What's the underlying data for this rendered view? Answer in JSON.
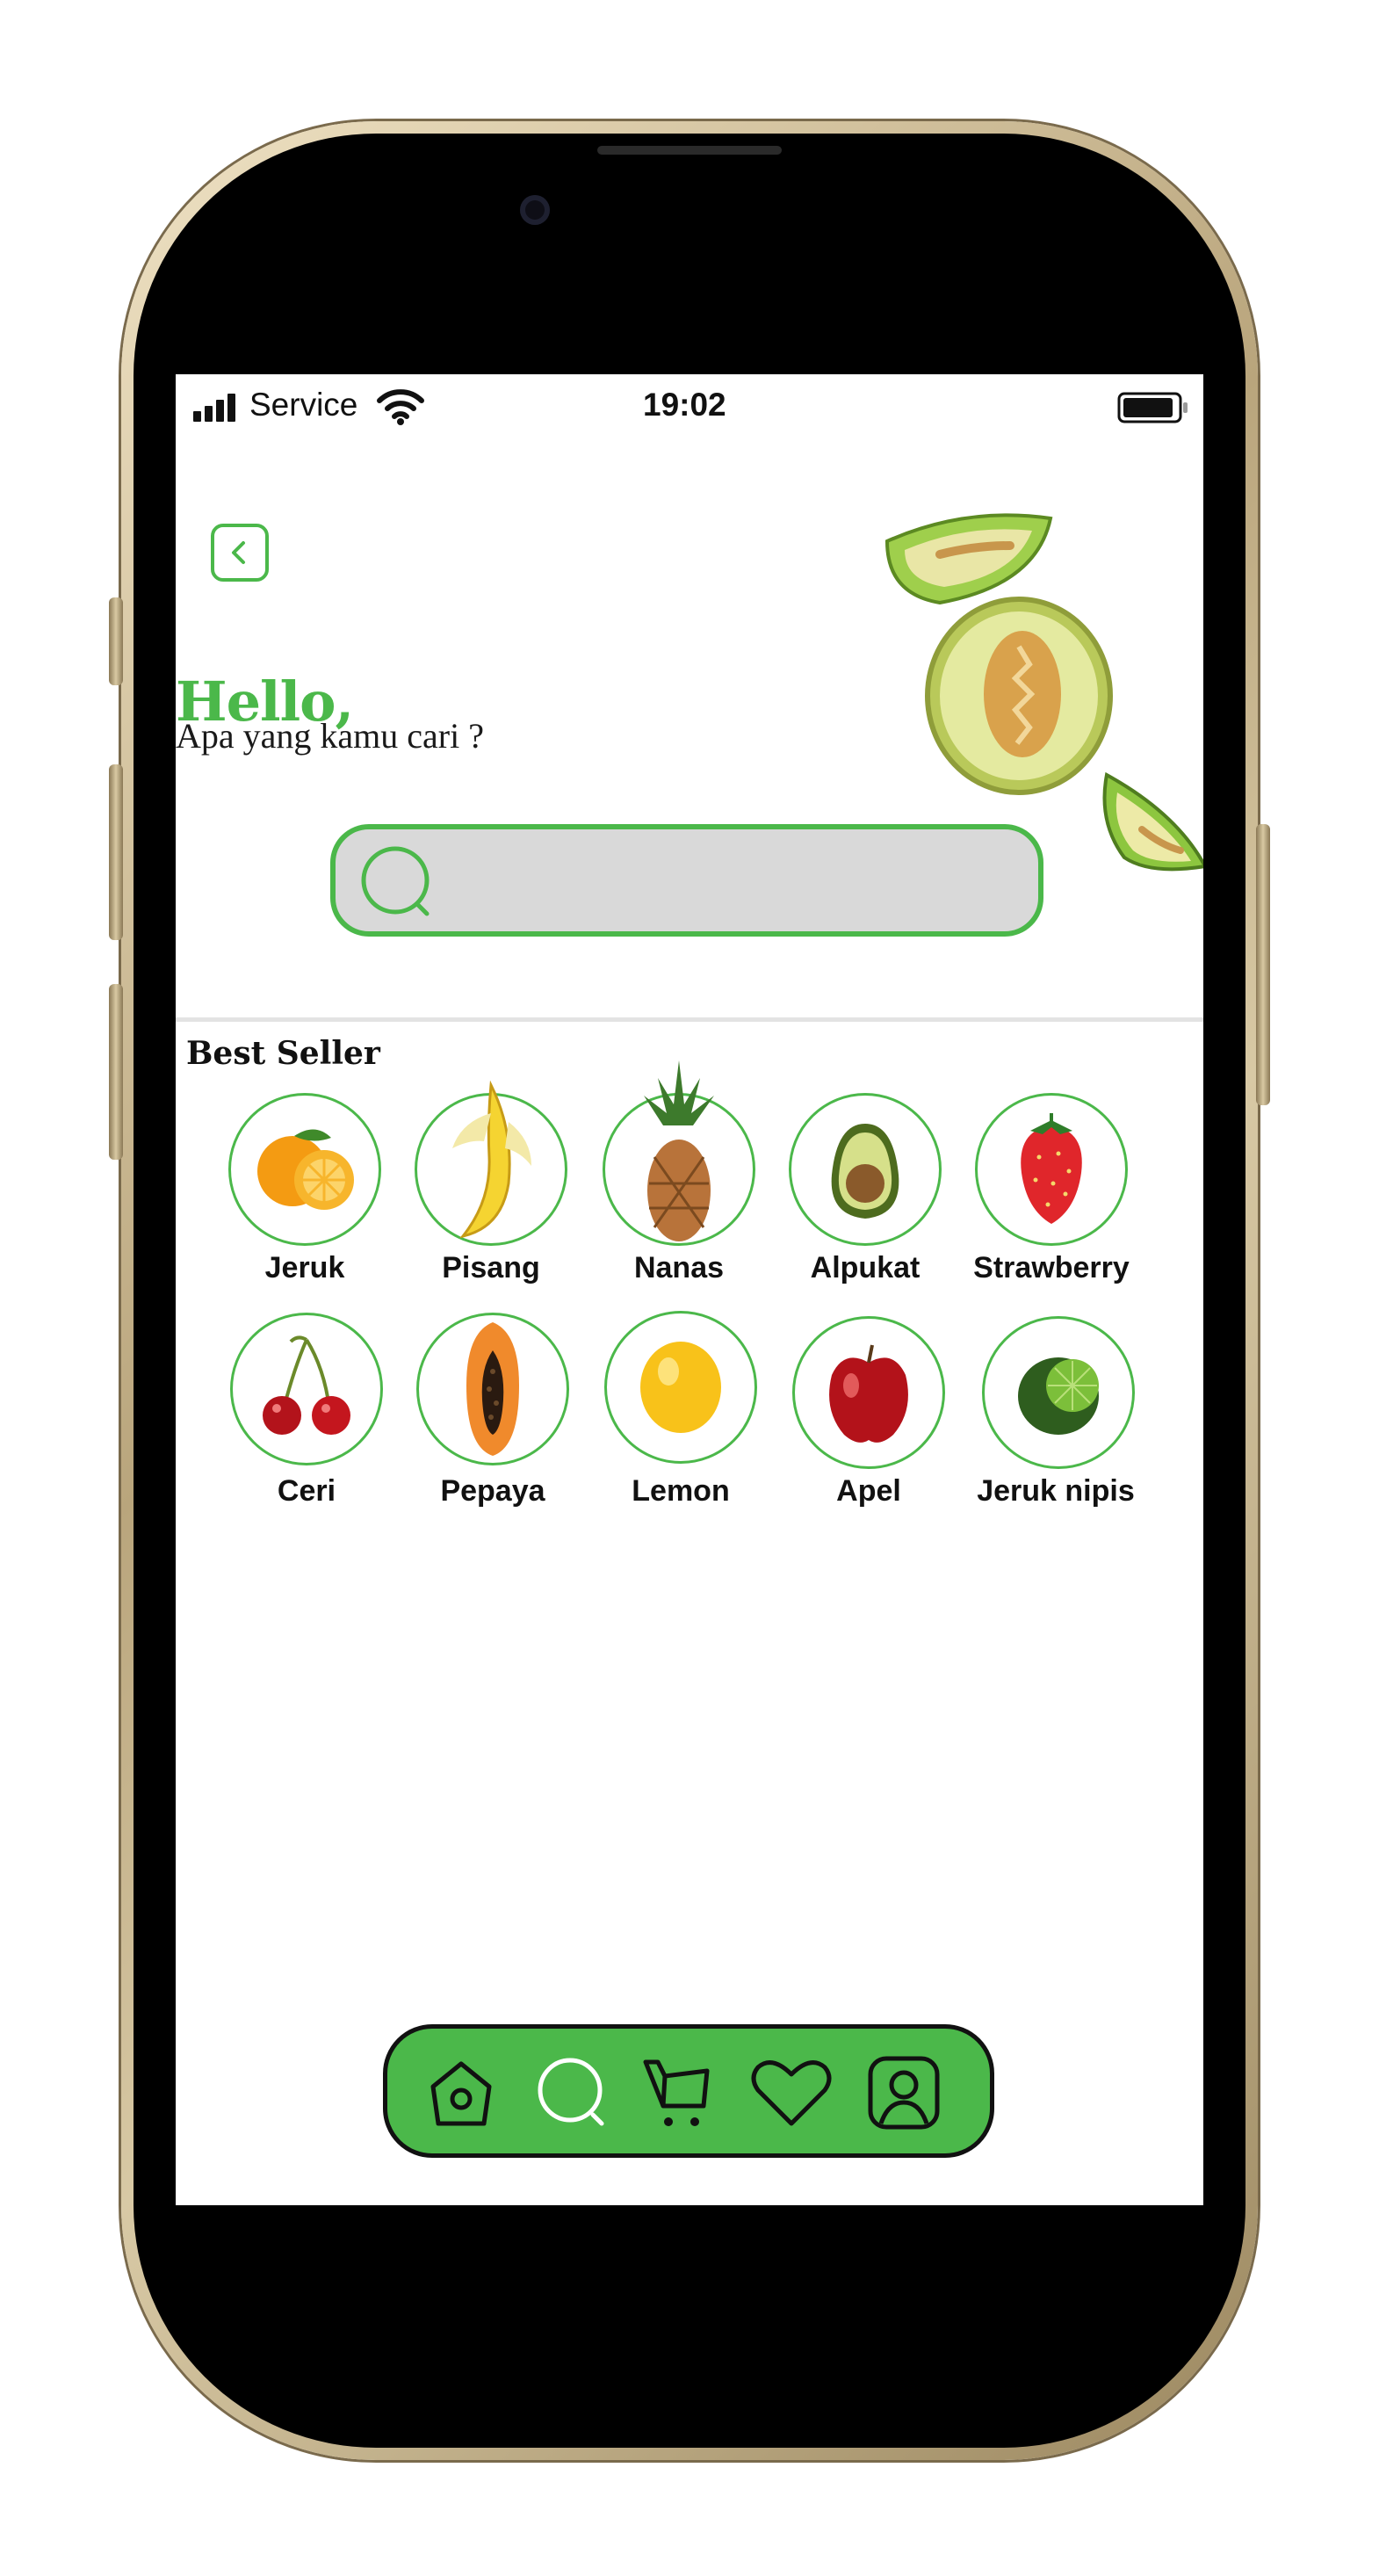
{
  "status_bar": {
    "carrier": "Service",
    "time": "19:02"
  },
  "header": {
    "greeting": "Hello,",
    "subtitle": "Apa yang kamu cari ?"
  },
  "search": {
    "placeholder": ""
  },
  "best_seller": {
    "title": "Best Seller",
    "items": [
      {
        "label": "Jeruk"
      },
      {
        "label": "Pisang"
      },
      {
        "label": "Nanas"
      },
      {
        "label": "Alpukat"
      },
      {
        "label": "Strawberry"
      },
      {
        "label": "Ceri"
      },
      {
        "label": "Pepaya"
      },
      {
        "label": "Lemon"
      },
      {
        "label": "Apel"
      },
      {
        "label": "Jeruk nipis"
      }
    ]
  },
  "nav": {
    "icons": [
      "home-icon",
      "search-icon",
      "cart-icon",
      "heart-icon",
      "profile-icon"
    ]
  },
  "colors": {
    "accent": "#4bb84a",
    "search_fill": "#d9d9d9"
  }
}
